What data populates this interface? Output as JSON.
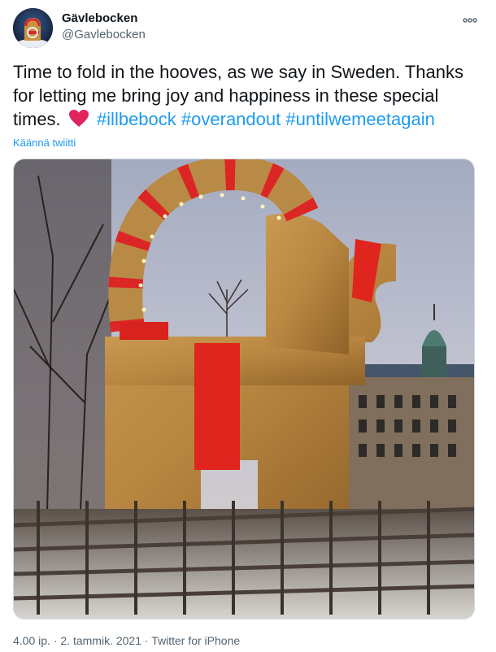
{
  "account": {
    "display_name": "Gävlebocken",
    "handle": "@Gavlebocken"
  },
  "tweet": {
    "text_part1": "Time to fold in the hooves, as we say in Sweden. Thanks for letting me bring joy and happiness in these special times.",
    "hashtags": [
      "#illbebock",
      "#overandout",
      "#untilwemeetagain"
    ],
    "translate_label": "Käännä twiitti",
    "timestamp": "4.00 ip.",
    "date": "2. tammik. 2021",
    "separator": "·",
    "client": "Twitter for iPhone"
  },
  "icons": {
    "more": "more-horizontal-icon",
    "heart": "red-heart-emoji"
  },
  "colors": {
    "link": "#1d9bf0",
    "text": "#0f1419",
    "muted": "#536471",
    "heart": "#e0245e"
  }
}
